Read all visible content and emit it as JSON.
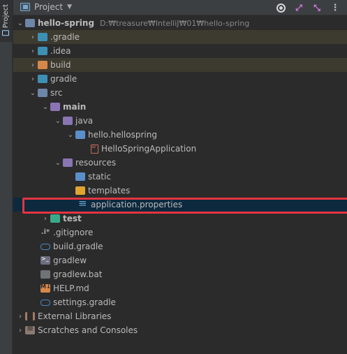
{
  "side": {
    "tab_label": "Project"
  },
  "header": {
    "title": "Project",
    "actions": [
      "target-icon",
      "expand-all-icon",
      "collapse-all-icon",
      "more-icon"
    ]
  },
  "tree": {
    "root_label": "hello-spring",
    "root_path": "D:₩treasure₩IntelliJ₩01₩hello-spring",
    "gradle_dir": ".gradle",
    "idea_dir": ".idea",
    "build_dir": "build",
    "gradle_folder": "gradle",
    "src": "src",
    "main": "main",
    "java": "java",
    "package": "hello.hellospring",
    "app_class": "HelloSpringApplication",
    "resources": "resources",
    "static_dir": "static",
    "templates_dir": "templates",
    "app_props": "application.properties",
    "test": "test",
    "gitignore": ".gitignore",
    "build_gradle": "build.gradle",
    "gradlew": "gradlew",
    "gradlew_bat": "gradlew.bat",
    "help_md": "HELP.md",
    "settings_gradle": "settings.gradle",
    "external_libs": "External Libraries",
    "scratches": "Scratches and Consoles"
  },
  "colors": {
    "background": "#2b2b2b",
    "header": "#3c3f41",
    "selection": "#0d293e",
    "highlight_box": "#e5343f",
    "excluded_row": "#3d3a2f"
  }
}
